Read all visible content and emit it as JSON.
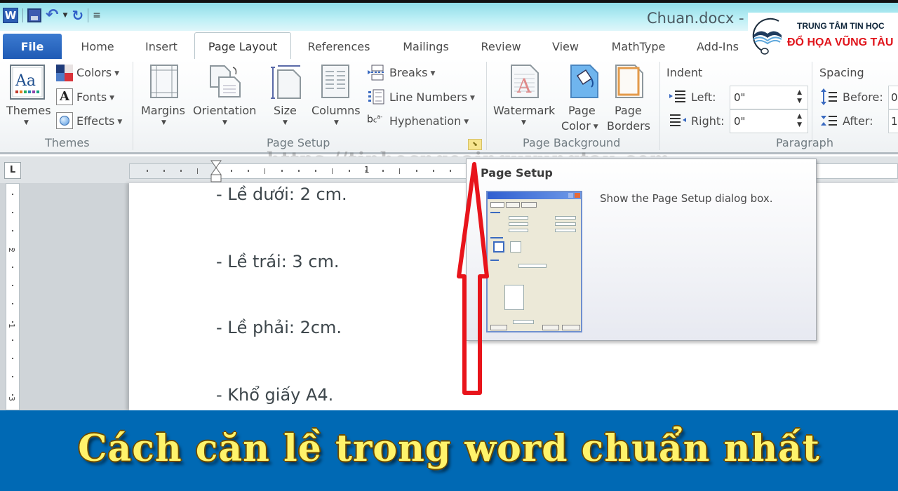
{
  "window": {
    "title": "Chuan.docx - Microsoft Word",
    "title_visible": "Chuan.docx -",
    "app_icon": "word-icon",
    "quick_access": [
      {
        "icon": "save-icon"
      },
      {
        "icon": "undo-icon"
      },
      {
        "icon": "redo-icon"
      },
      {
        "icon": "customize-qat-icon"
      }
    ]
  },
  "logo": {
    "line1": "TRUNG TÂM TIN HỌC",
    "line2": "ĐỔ HỌA VŨNG TÀU",
    "brand_red": "#e0141b"
  },
  "tabs": [
    {
      "label": "File"
    },
    {
      "label": "Home"
    },
    {
      "label": "Insert"
    },
    {
      "label": "Page Layout",
      "active": true
    },
    {
      "label": "References"
    },
    {
      "label": "Mailings"
    },
    {
      "label": "Review"
    },
    {
      "label": "View"
    },
    {
      "label": "MathType"
    },
    {
      "label": "Add-Ins"
    }
  ],
  "ribbon": {
    "themes_group": {
      "label": "Themes",
      "themes_button": "Themes",
      "colors": "Colors",
      "fonts": "Fonts",
      "effects": "Effects"
    },
    "page_setup_group": {
      "label": "Page Setup",
      "margins": "Margins",
      "orientation": "Orientation",
      "size": "Size",
      "columns": "Columns",
      "breaks": "Breaks",
      "line_numbers": "Line Numbers",
      "hyphenation": "Hyphenation"
    },
    "page_background_group": {
      "label": "Page Background",
      "watermark": "Watermark",
      "page_color_line1": "Page",
      "page_color_line2": "Color",
      "page_borders_line1": "Page",
      "page_borders_line2": "Borders"
    },
    "paragraph_group": {
      "label": "Paragraph",
      "indent_heading": "Indent",
      "left_label": "Left:",
      "left_value": "0\"",
      "right_label": "Right:",
      "right_value": "0\"",
      "spacing_heading": "Spacing",
      "before_label": "Before:",
      "before_value": "0",
      "after_label": "After:",
      "after_value": "1"
    }
  },
  "watermark_overlay": "https://tinhocngoainguvungtau.com",
  "ruler": {
    "tab_selector": "L",
    "h_numbers": [
      "1"
    ],
    "v_numbers": [
      "2",
      "1",
      "3"
    ]
  },
  "tooltip": {
    "title": "Page Setup",
    "description": "Show the Page Setup dialog box."
  },
  "document": {
    "lines": [
      "- Lề dưới: 2 cm.",
      "- Lề trái: 3 cm.",
      "- Lề phải: 2cm.",
      "- Khổ giấy A4."
    ]
  },
  "banner": {
    "title": "Cách căn lề trong word chuẩn nhất",
    "background": "#0069b4",
    "text_color": "#fff36b"
  },
  "annotation": {
    "arrow_color": "#e8141b"
  }
}
